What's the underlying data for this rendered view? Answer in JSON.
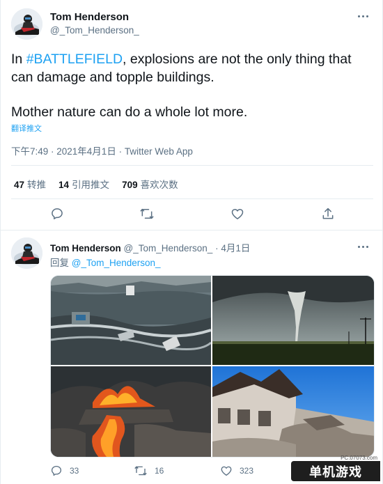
{
  "main_tweet": {
    "author_name": "Tom Henderson",
    "author_handle": "@_Tom_Henderson_",
    "text_prefix": "In ",
    "hashtag": "#BATTLEFIELD",
    "text_line1_rest": ", explosions are not the only thing that",
    "text_line2": "can damage and topple buildings.",
    "text_line3": "Mother nature can do a whole lot more.",
    "translate_label": "翻译推文",
    "timestamp": "下午7:49 · 2021年4月1日",
    "separator": " · ",
    "source": "Twitter Web App",
    "stats": {
      "retweets_count": "47",
      "retweets_label": "转推",
      "quotes_count": "14",
      "quotes_label": "引用推文",
      "likes_count": "709",
      "likes_label": "喜欢次数"
    },
    "action_icons": [
      "reply-icon",
      "retweet-icon",
      "like-icon",
      "share-icon"
    ]
  },
  "reply_tweet": {
    "author_name": "Tom Henderson",
    "author_handle": "@_Tom_Henderson_",
    "dot": " · ",
    "date": "4月1日",
    "reply_prefix": "回复 ",
    "reply_mention": "@_Tom_Henderson_",
    "media": [
      "tsunami-photo",
      "tornado-photo",
      "volcano-lava-photo",
      "destroyed-building-photo"
    ],
    "reply_count": "33",
    "retweet_count": "16",
    "like_count": "323"
  },
  "watermark": {
    "url": "PC.07073.com",
    "label": "单机游戏"
  },
  "colors": {
    "accent": "#1da1f2",
    "text_primary": "#0f1419",
    "text_secondary": "#5b7083",
    "divider": "#e6ecf0"
  }
}
